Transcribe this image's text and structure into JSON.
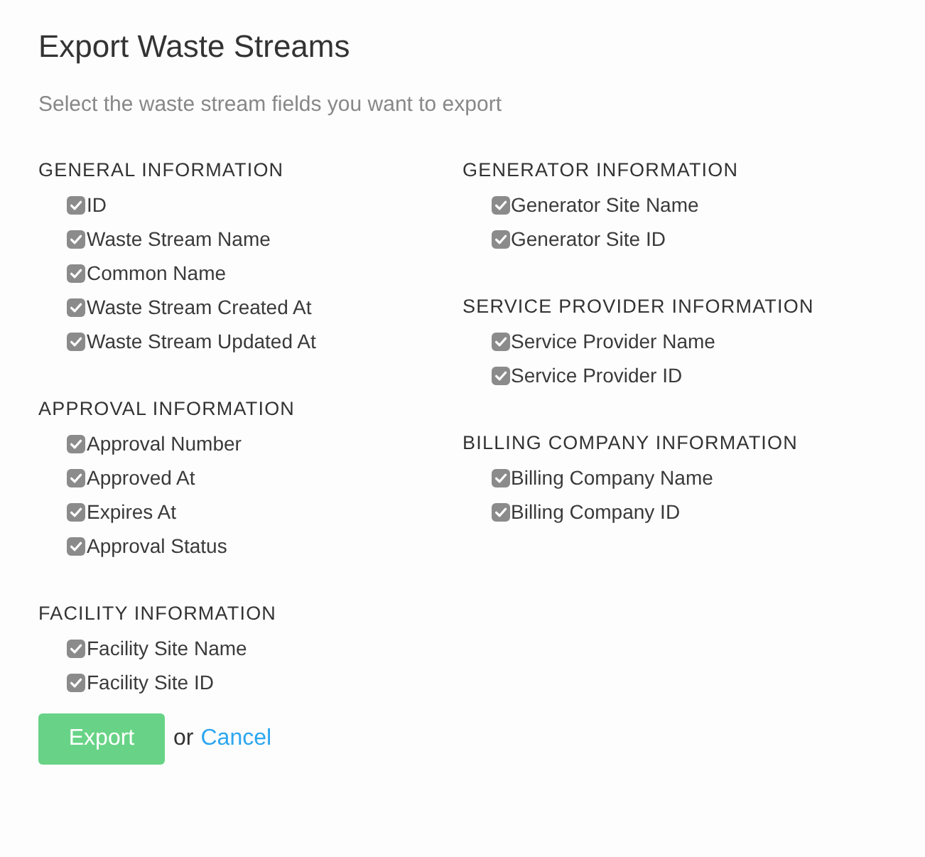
{
  "dialog": {
    "title": "Export Waste Streams",
    "subtitle": "Select the waste stream fields you want to export"
  },
  "columns": [
    [
      {
        "heading": "GENERAL INFORMATION",
        "fields": [
          {
            "label": "ID",
            "checked": true
          },
          {
            "label": "Waste Stream Name",
            "checked": true
          },
          {
            "label": "Common Name",
            "checked": true
          },
          {
            "label": "Waste Stream Created At",
            "checked": true
          },
          {
            "label": "Waste Stream Updated At",
            "checked": true
          }
        ]
      },
      {
        "heading": "APPROVAL INFORMATION",
        "fields": [
          {
            "label": "Approval Number",
            "checked": true
          },
          {
            "label": "Approved At",
            "checked": true
          },
          {
            "label": "Expires At",
            "checked": true
          },
          {
            "label": "Approval Status",
            "checked": true
          }
        ]
      },
      {
        "heading": "FACILITY INFORMATION",
        "fields": [
          {
            "label": "Facility Site Name",
            "checked": true
          },
          {
            "label": "Facility Site ID",
            "checked": true
          }
        ]
      }
    ],
    [
      {
        "heading": "GENERATOR INFORMATION",
        "fields": [
          {
            "label": "Generator Site Name",
            "checked": true
          },
          {
            "label": "Generator Site ID",
            "checked": true
          }
        ]
      },
      {
        "heading": "SERVICE PROVIDER INFORMATION",
        "fields": [
          {
            "label": "Service Provider Name",
            "checked": true
          },
          {
            "label": "Service Provider ID",
            "checked": true
          }
        ]
      },
      {
        "heading": "BILLING COMPANY INFORMATION",
        "fields": [
          {
            "label": "Billing Company Name",
            "checked": true
          },
          {
            "label": "Billing Company ID",
            "checked": true
          }
        ]
      }
    ]
  ],
  "actions": {
    "export": "Export",
    "separator": "or",
    "cancel": "Cancel"
  }
}
